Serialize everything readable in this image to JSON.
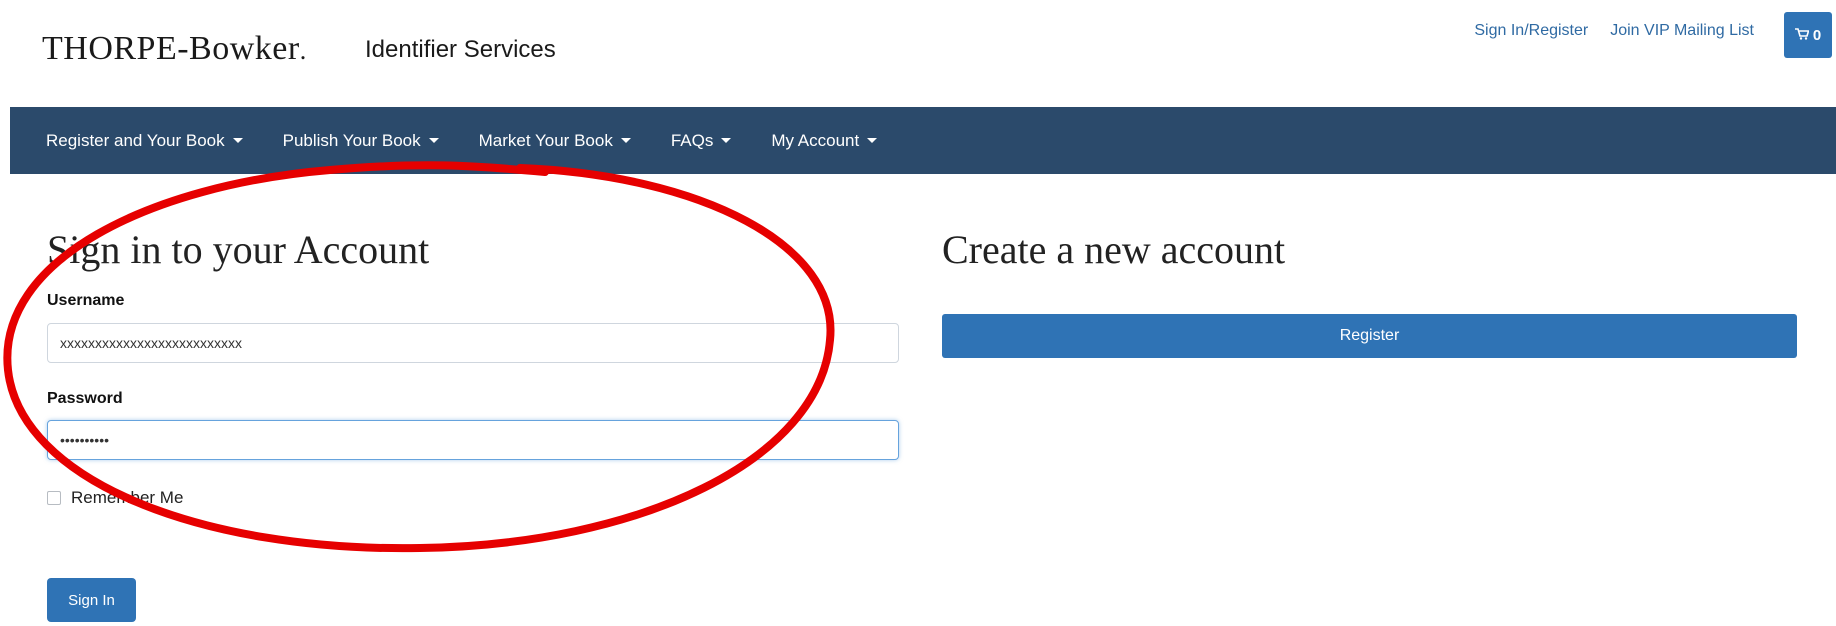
{
  "header": {
    "logo_main": "THORPE-Bowker",
    "logo_suffix": ".",
    "identifier": "Identifier Services",
    "links": [
      "Sign In/Register",
      "Join VIP Mailing List"
    ],
    "cart_icon": "shopping-cart-icon",
    "cart_count": "0"
  },
  "nav": {
    "items": [
      {
        "label": "Register and Your Book"
      },
      {
        "label": "Publish Your Book"
      },
      {
        "label": "Market Your Book"
      },
      {
        "label": "FAQs"
      },
      {
        "label": "My Account"
      }
    ]
  },
  "signin": {
    "title": "Sign in to your Account",
    "username_label": "Username",
    "username_value": "xxxxxxxxxxxxxxxxxxxxxxxxxx",
    "password_label": "Password",
    "password_value": "••••••••••",
    "remember_label": "Remember Me",
    "button": "Sign In"
  },
  "create": {
    "title": "Create a new account",
    "button": "Register"
  },
  "colors": {
    "nav_bg": "#2b4a6b",
    "primary": "#2f73b5",
    "link": "#2f6aa3",
    "annotation": "#e60000"
  }
}
